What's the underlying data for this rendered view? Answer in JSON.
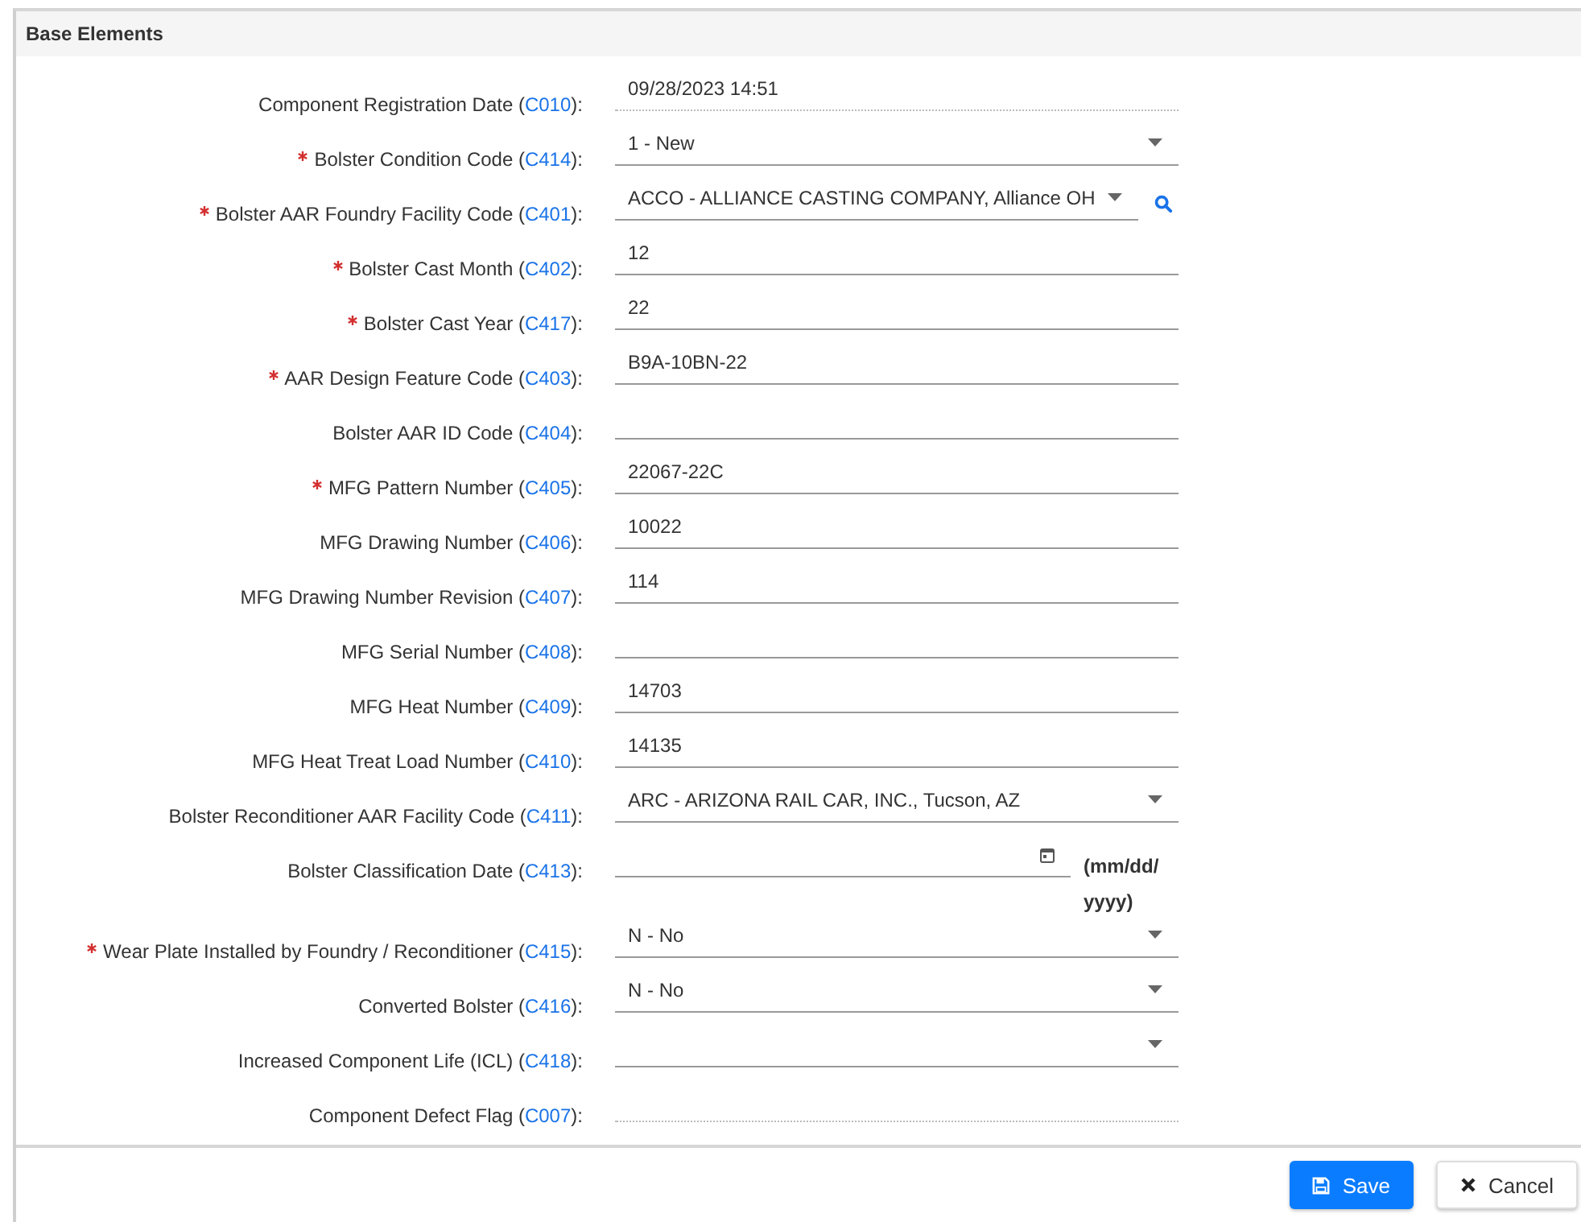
{
  "panel": {
    "title": "Base Elements"
  },
  "fields": [
    {
      "kind": "readonly",
      "required": false,
      "label": "Component Registration Date (",
      "code": "C010",
      "label_end": "):",
      "value": "09/28/2023 14:51"
    },
    {
      "kind": "select",
      "required": true,
      "label": "Bolster Condition Code (",
      "code": "C414",
      "label_end": "):",
      "value": "1 - New"
    },
    {
      "kind": "lookup",
      "required": true,
      "label": "Bolster AAR Foundry Facility Code (",
      "code": "C401",
      "label_end": "):",
      "value": "ACCO - ALLIANCE CASTING COMPANY, Alliance OH"
    },
    {
      "kind": "text",
      "required": true,
      "label": "Bolster Cast Month (",
      "code": "C402",
      "label_end": "):",
      "value": "12"
    },
    {
      "kind": "text",
      "required": true,
      "label": "Bolster Cast Year (",
      "code": "C417",
      "label_end": "):",
      "value": "22"
    },
    {
      "kind": "text",
      "required": true,
      "label": "AAR Design Feature Code (",
      "code": "C403",
      "label_end": "):",
      "value": "B9A-10BN-22"
    },
    {
      "kind": "text",
      "required": false,
      "label": "Bolster AAR ID Code (",
      "code": "C404",
      "label_end": "):"
    },
    {
      "kind": "text",
      "required": true,
      "label": "MFG Pattern Number (",
      "code": "C405",
      "label_end": "):",
      "value": "22067-22C"
    },
    {
      "kind": "text",
      "required": false,
      "label": "MFG Drawing Number (",
      "code": "C406",
      "label_end": "):",
      "value": "10022"
    },
    {
      "kind": "text",
      "required": false,
      "label": "MFG Drawing Number Revision (",
      "code": "C407",
      "label_end": "):",
      "value": "114"
    },
    {
      "kind": "text",
      "required": false,
      "label": "MFG Serial Number (",
      "code": "C408",
      "label_end": "):"
    },
    {
      "kind": "text",
      "required": false,
      "label": "MFG Heat Number (",
      "code": "C409",
      "label_end": "):",
      "value": "14703"
    },
    {
      "kind": "text",
      "required": false,
      "label": "MFG Heat Treat Load Number (",
      "code": "C410",
      "label_end": "):",
      "value": "14135"
    },
    {
      "kind": "select",
      "required": false,
      "label": "Bolster Reconditioner AAR Facility Code (",
      "code": "C411",
      "label_end": "):",
      "value": "ARC - ARIZONA RAIL CAR, INC., Tucson, AZ"
    },
    {
      "kind": "date",
      "required": false,
      "label": "Bolster Classification Date (",
      "code": "C413",
      "label_end": "):",
      "hint": "(mm/dd/yyyy)"
    },
    {
      "kind": "select",
      "required": true,
      "label": "Wear Plate Installed by Foundry / Reconditioner (",
      "code": "C415",
      "label_end": "):",
      "value": "N - No"
    },
    {
      "kind": "select",
      "required": false,
      "label": "Converted Bolster (",
      "code": "C416",
      "label_end": "):",
      "value": "N - No"
    },
    {
      "kind": "select",
      "required": false,
      "label": "Increased Component Life (ICL) (",
      "code": "C418",
      "label_end": "):"
    },
    {
      "kind": "readonly",
      "required": false,
      "label": "Component Defect Flag (",
      "code": "C007",
      "label_end": "):"
    }
  ],
  "buttons": [
    {
      "kind": "primary",
      "label": "Save"
    },
    {
      "kind": "secondary",
      "label": "Cancel"
    }
  ]
}
